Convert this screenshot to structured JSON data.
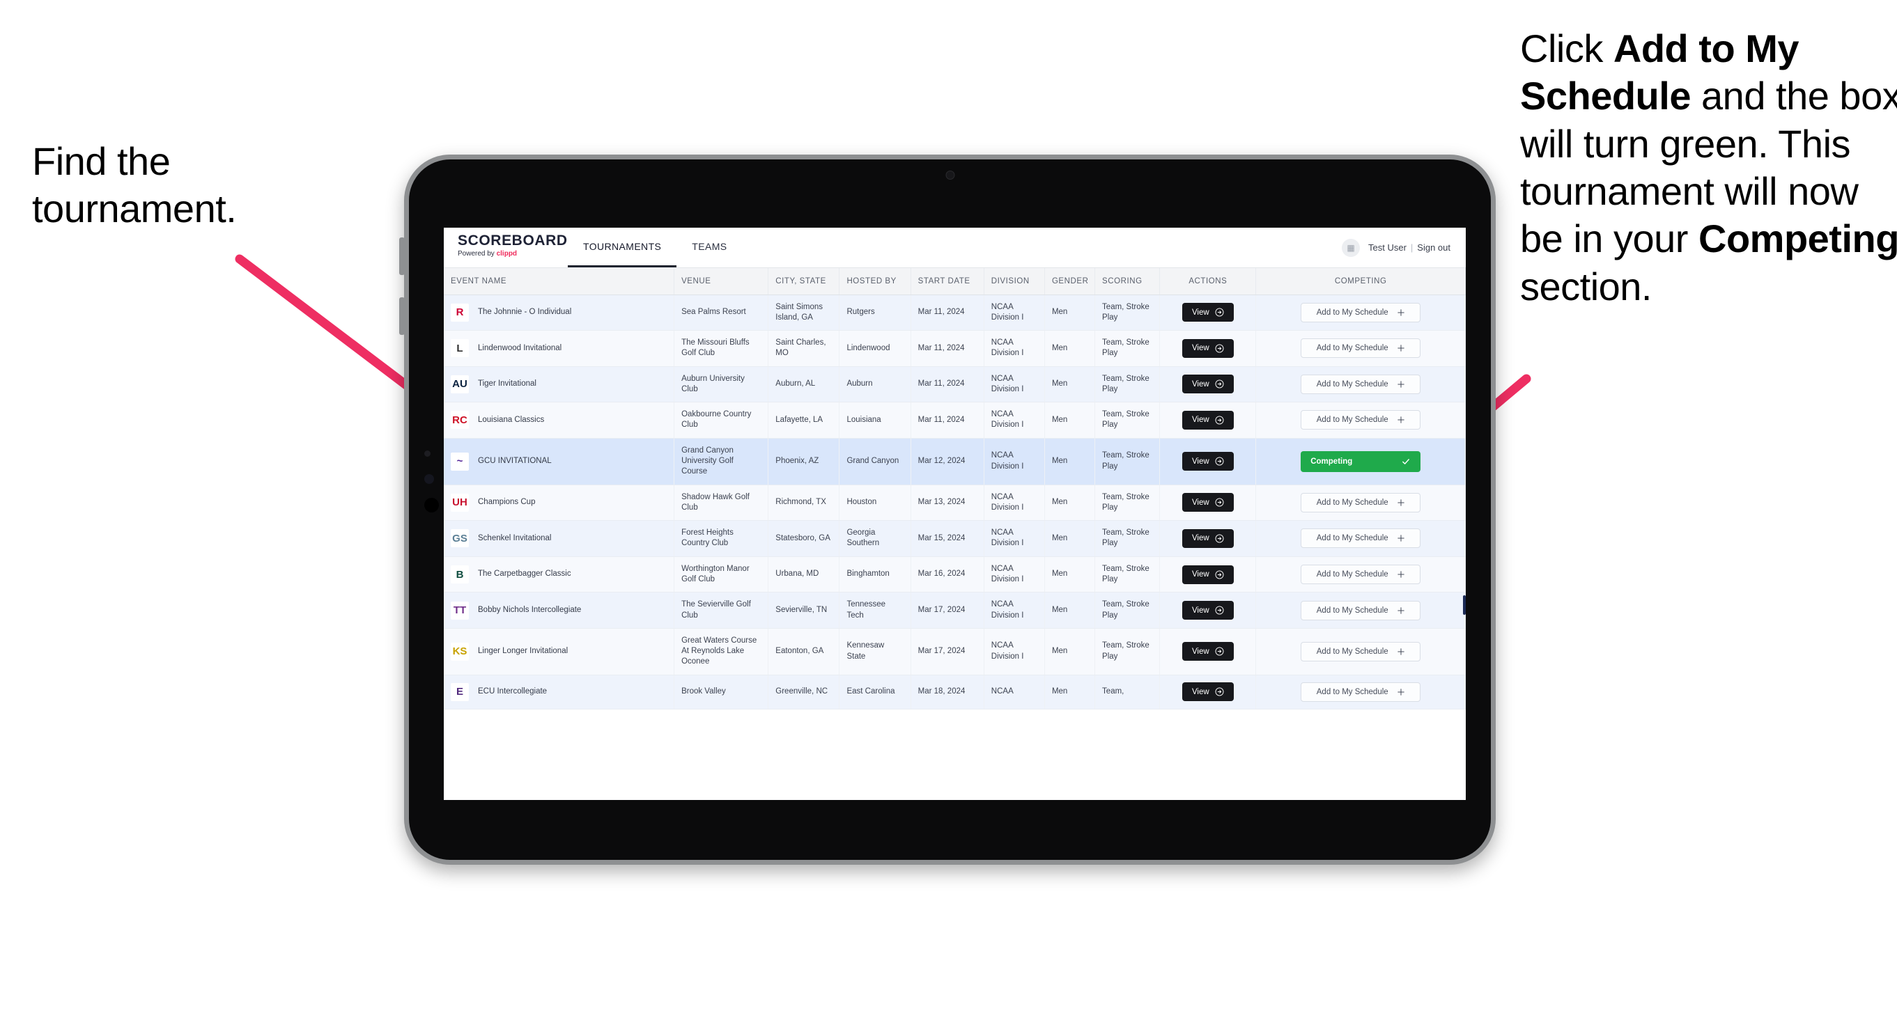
{
  "annotations": {
    "left": {
      "lines": [
        "Find the",
        "tournament."
      ]
    },
    "right": {
      "segments": [
        {
          "text": "Click ",
          "bold": false
        },
        {
          "text": "Add to My Schedule",
          "bold": true
        },
        {
          "text": " and the box will turn green. This tournament will now be in your ",
          "bold": false
        },
        {
          "text": "Competing",
          "bold": true
        },
        {
          "text": " section.",
          "bold": false
        }
      ]
    },
    "arrow_color": "#ee2e62"
  },
  "app": {
    "brand": {
      "name": "SCOREBOARD",
      "powered_prefix": "Powered by ",
      "powered_brand": "clippd"
    },
    "nav": [
      {
        "label": "TOURNAMENTS",
        "active": true
      },
      {
        "label": "TEAMS",
        "active": false
      }
    ],
    "account": {
      "avatar_icon": "user-badge-icon",
      "user": "Test User",
      "separator": "|",
      "signout": "Sign out"
    },
    "table": {
      "columns": [
        "EVENT NAME",
        "VENUE",
        "CITY, STATE",
        "HOSTED BY",
        "START DATE",
        "DIVISION",
        "GENDER",
        "SCORING",
        "ACTIONS",
        "COMPETING"
      ],
      "view_label": "View",
      "add_label": "Add to My Schedule",
      "add_icon": "plus-icon",
      "competing_label": "Competing",
      "competing_icon": "check-icon",
      "competing_color": "#1faa4b",
      "rows": [
        {
          "logo": {
            "text": "R",
            "color": "#cc0033",
            "bg": "#ffffff",
            "name": "rutgers-logo"
          },
          "event": "The Johnnie - O Individual",
          "venue": "Sea Palms Resort",
          "city": "Saint Simons Island, GA",
          "host": "Rutgers",
          "date": "Mar 11, 2024",
          "division": "NCAA Division I",
          "gender": "Men",
          "scoring": "Team, Stroke Play",
          "competing": false
        },
        {
          "logo": {
            "text": "L",
            "color": "#2f2f2f",
            "bg": "#ffffff",
            "name": "lindenwood-logo"
          },
          "event": "Lindenwood Invitational",
          "venue": "The Missouri Bluffs Golf Club",
          "city": "Saint Charles, MO",
          "host": "Lindenwood",
          "date": "Mar 11, 2024",
          "division": "NCAA Division I",
          "gender": "Men",
          "scoring": "Team, Stroke Play",
          "competing": false
        },
        {
          "logo": {
            "text": "AU",
            "color": "#0c2340",
            "bg": "#ffffff",
            "name": "auburn-logo"
          },
          "event": "Tiger Invitational",
          "venue": "Auburn University Club",
          "city": "Auburn, AL",
          "host": "Auburn",
          "date": "Mar 11, 2024",
          "division": "NCAA Division I",
          "gender": "Men",
          "scoring": "Team, Stroke Play",
          "competing": false
        },
        {
          "logo": {
            "text": "RC",
            "color": "#ce1126",
            "bg": "#ffffff",
            "name": "louisiana-ragin-cajuns-logo"
          },
          "event": "Louisiana Classics",
          "venue": "Oakbourne Country Club",
          "city": "Lafayette, LA",
          "host": "Louisiana",
          "date": "Mar 11, 2024",
          "division": "NCAA Division I",
          "gender": "Men",
          "scoring": "Team, Stroke Play",
          "competing": false
        },
        {
          "logo": {
            "text": "~",
            "color": "#522398",
            "bg": "#ffffff",
            "name": "grand-canyon-lopes-logo"
          },
          "event": "GCU INVITATIONAL",
          "venue": "Grand Canyon University Golf Course",
          "city": "Phoenix, AZ",
          "host": "Grand Canyon",
          "date": "Mar 12, 2024",
          "division": "NCAA Division I",
          "gender": "Men",
          "scoring": "Team, Stroke Play",
          "competing": true
        },
        {
          "logo": {
            "text": "UH",
            "color": "#c8102e",
            "bg": "#ffffff",
            "name": "houston-logo"
          },
          "event": "Champions Cup",
          "venue": "Shadow Hawk Golf Club",
          "city": "Richmond, TX",
          "host": "Houston",
          "date": "Mar 13, 2024",
          "division": "NCAA Division I",
          "gender": "Men",
          "scoring": "Team, Stroke Play",
          "competing": false
        },
        {
          "logo": {
            "text": "GS",
            "color": "#5b7f95",
            "bg": "#ffffff",
            "name": "georgia-southern-logo"
          },
          "event": "Schenkel Invitational",
          "venue": "Forest Heights Country Club",
          "city": "Statesboro, GA",
          "host": "Georgia Southern",
          "date": "Mar 15, 2024",
          "division": "NCAA Division I",
          "gender": "Men",
          "scoring": "Team, Stroke Play",
          "competing": false
        },
        {
          "logo": {
            "text": "B",
            "color": "#0f4d3f",
            "bg": "#ffffff",
            "name": "binghamton-logo"
          },
          "event": "The Carpetbagger Classic",
          "venue": "Worthington Manor Golf Club",
          "city": "Urbana, MD",
          "host": "Binghamton",
          "date": "Mar 16, 2024",
          "division": "NCAA Division I",
          "gender": "Men",
          "scoring": "Team, Stroke Play",
          "competing": false
        },
        {
          "logo": {
            "text": "TT",
            "color": "#702f8a",
            "bg": "#ffffff",
            "name": "tennessee-tech-logo"
          },
          "event": "Bobby Nichols Intercollegiate",
          "venue": "The Sevierville Golf Club",
          "city": "Sevierville, TN",
          "host": "Tennessee Tech",
          "date": "Mar 17, 2024",
          "division": "NCAA Division I",
          "gender": "Men",
          "scoring": "Team, Stroke Play",
          "competing": false
        },
        {
          "logo": {
            "text": "KS",
            "color": "#c8a200",
            "bg": "#ffffff",
            "name": "kennesaw-state-logo"
          },
          "event": "Linger Longer Invitational",
          "venue": "Great Waters Course At Reynolds Lake Oconee",
          "city": "Eatonton, GA",
          "host": "Kennesaw State",
          "date": "Mar 17, 2024",
          "division": "NCAA Division I",
          "gender": "Men",
          "scoring": "Team, Stroke Play",
          "competing": false
        },
        {
          "logo": {
            "text": "E",
            "color": "#512a7d",
            "bg": "#ffffff",
            "name": "east-carolina-logo"
          },
          "event": "ECU Intercollegiate",
          "venue": "Brook Valley",
          "city": "Greenville, NC",
          "host": "East Carolina",
          "date": "Mar 18, 2024",
          "division": "NCAA",
          "gender": "Men",
          "scoring": "Team,",
          "competing": false
        }
      ]
    }
  }
}
